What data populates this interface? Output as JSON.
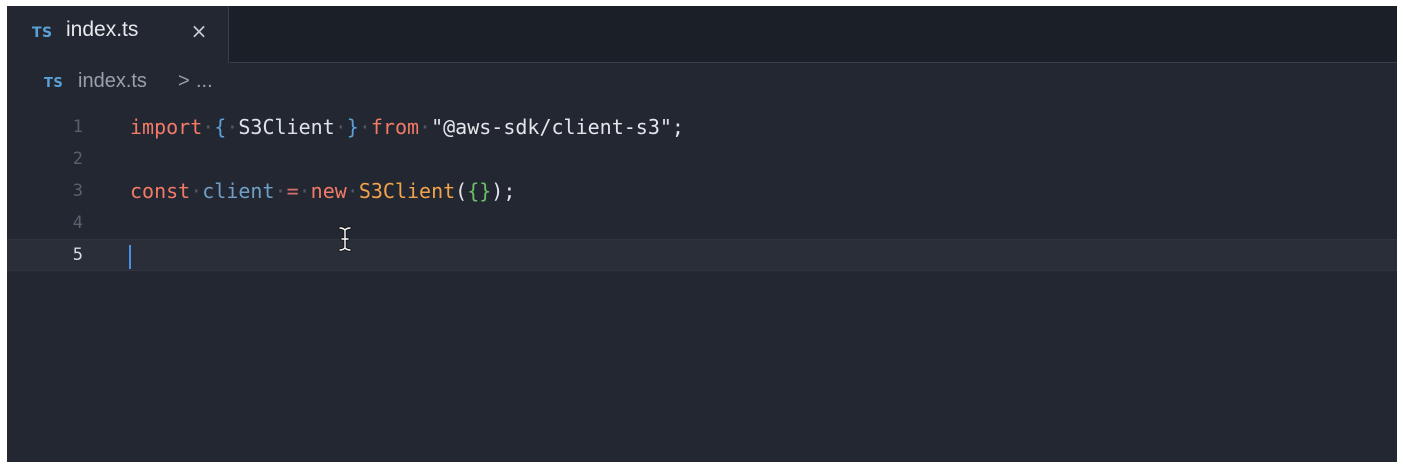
{
  "tab": {
    "icon": "typescript-file-icon",
    "badge": "TS",
    "title": "index.ts",
    "close": "×"
  },
  "breadcrumb": {
    "badge": "TS",
    "file": "index.ts",
    "separator": ">",
    "more": "..."
  },
  "editor": {
    "active_line": 5,
    "lines": [
      {
        "number": "1"
      },
      {
        "number": "2"
      },
      {
        "number": "3"
      },
      {
        "number": "4"
      },
      {
        "number": "5"
      }
    ],
    "line1": {
      "kw_import": "import",
      "open_brace": "{",
      "name": "S3Client",
      "close_brace": "}",
      "kw_from": "from",
      "module": "\"@aws-sdk/client-s3\"",
      "semi": ";"
    },
    "line3": {
      "kw_const": "const",
      "var": "client",
      "op": "=",
      "kw_new": "new",
      "cls": "S3Client",
      "open_paren": "(",
      "obj": "{}",
      "close_paren": ")",
      "semi": ";"
    },
    "whitespace_marker": "·"
  },
  "colors": {
    "background": "#232731",
    "tabbar": "#1b1f27",
    "keyword": "#f27a66",
    "class": "#f2a24a",
    "object": "#6bbf6a",
    "brace": "#5aa1d8",
    "cursor": "#4a90e2"
  }
}
